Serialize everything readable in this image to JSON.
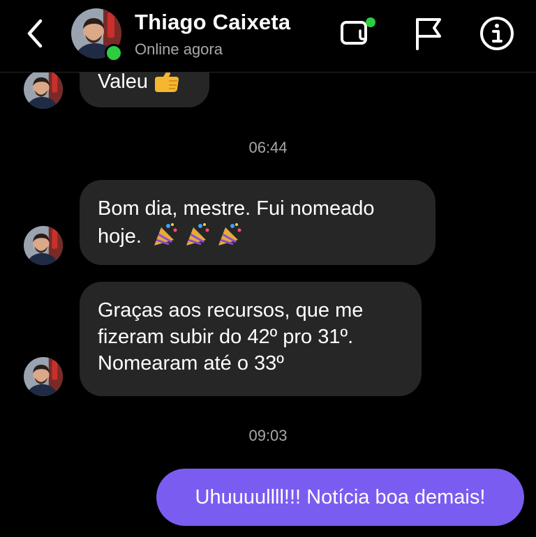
{
  "header": {
    "contact_name": "Thiago Caixeta",
    "status": "Online agora"
  },
  "messages": [
    {
      "sender": "contact",
      "text": "Valeu"
    },
    {
      "sender": "contact",
      "time": "06:44"
    },
    {
      "sender": "contact",
      "text_line1": "Bom dia, mestre. Fui nomeado",
      "text_line2": "hoje."
    },
    {
      "sender": "contact",
      "line1": "Graças aos recursos, que me",
      "line2": "fizeram subir do 42º pro 31º.",
      "line3": "Nomearam até o 33º"
    },
    {
      "time": "09:03"
    },
    {
      "sender": "me",
      "text": "Uhuuuullll!!! Notícia boa demais!"
    }
  ],
  "colors": {
    "background": "#000000",
    "incoming_bubble": "#262626",
    "outgoing_bubble": "#7b5cf0",
    "online_indicator": "#2ecc40",
    "muted_text": "#a8a8a8"
  },
  "icons": [
    "back-chevron-icon",
    "video-call-icon",
    "flag-icon",
    "info-icon",
    "thumbs-up-emoji",
    "party-popper-emoji"
  ]
}
